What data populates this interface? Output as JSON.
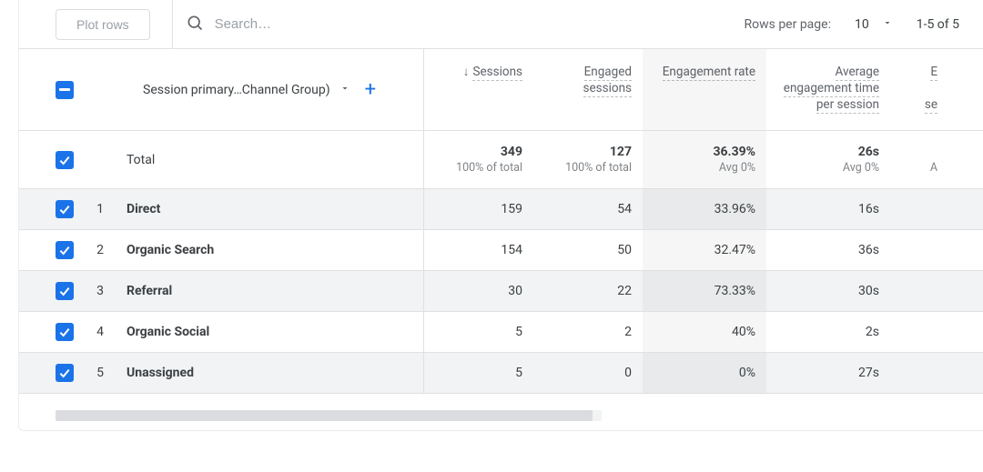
{
  "toolbar": {
    "plot_label": "Plot rows",
    "search_placeholder": "Search…",
    "rows_per_page_label": "Rows per page:",
    "rows_per_page_value": "10",
    "range_text": "1-5 of 5"
  },
  "dimension": {
    "label": "Session primary…Channel Group)"
  },
  "columns": {
    "sessions": "Sessions",
    "engaged_sessions": "Engaged sessions",
    "engagement_rate": "Engagement rate",
    "avg_engagement_time": "Average engagement time per session",
    "events_partial": "E",
    "events_sub_partial": "se"
  },
  "totals": {
    "label": "Total",
    "sessions": "349",
    "sessions_sub": "100% of total",
    "engaged_sessions": "127",
    "engaged_sessions_sub": "100% of total",
    "engagement_rate": "36.39%",
    "engagement_rate_sub": "Avg 0%",
    "avg_time": "26s",
    "avg_time_sub": "Avg 0%",
    "events_sub_partial": "A"
  },
  "rows": [
    {
      "idx": "1",
      "name": "Direct",
      "sessions": "159",
      "engaged": "54",
      "rate": "33.96%",
      "time": "16s"
    },
    {
      "idx": "2",
      "name": "Organic Search",
      "sessions": "154",
      "engaged": "50",
      "rate": "32.47%",
      "time": "36s"
    },
    {
      "idx": "3",
      "name": "Referral",
      "sessions": "30",
      "engaged": "22",
      "rate": "73.33%",
      "time": "30s"
    },
    {
      "idx": "4",
      "name": "Organic Social",
      "sessions": "5",
      "engaged": "2",
      "rate": "40%",
      "time": "2s"
    },
    {
      "idx": "5",
      "name": "Unassigned",
      "sessions": "5",
      "engaged": "0",
      "rate": "0%",
      "time": "27s"
    }
  ]
}
